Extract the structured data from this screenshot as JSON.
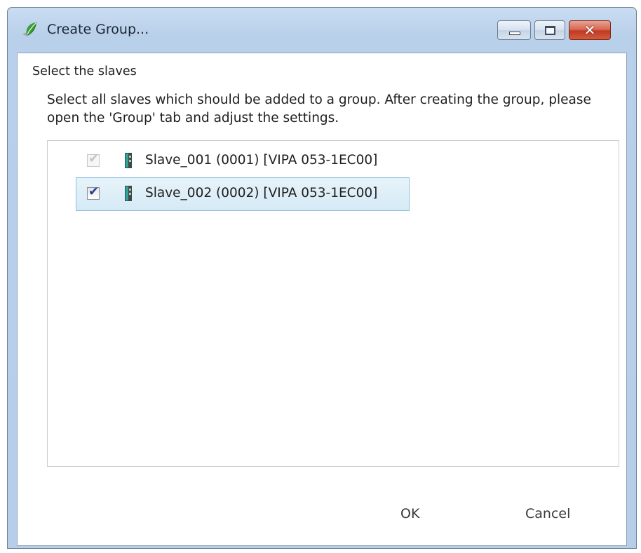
{
  "window": {
    "title": "Create Group...",
    "icons": {
      "app": "green-leaf-app-icon",
      "minimize": "minimize-icon",
      "maximize": "maximize-icon",
      "close": "close-icon"
    },
    "close_glyph": "✕"
  },
  "content": {
    "section_title": "Select the slaves",
    "instructions": "Select all slaves which should be added to a group. After creating the group, please open the 'Group' tab and adjust the settings."
  },
  "slaves": [
    {
      "label": "Slave_001 (0001) [VIPA 053-1EC00]",
      "checked": true,
      "enabled": false,
      "selected": false,
      "icon": "slave-device-icon"
    },
    {
      "label": "Slave_002 (0002) [VIPA 053-1EC00]",
      "checked": true,
      "enabled": true,
      "selected": true,
      "icon": "slave-device-icon"
    }
  ],
  "buttons": {
    "ok": "OK",
    "cancel": "Cancel"
  },
  "colors": {
    "selection_fill": "#d9ecf7",
    "selection_border": "#8ec0dc",
    "check_color": "#263c9a",
    "device_teal": "#2fa39a"
  }
}
